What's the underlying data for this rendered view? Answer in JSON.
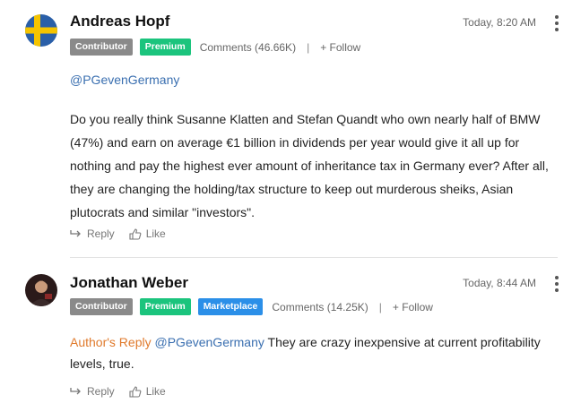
{
  "comments": [
    {
      "author": "Andreas Hopf",
      "avatar_icon": "sweden-flag-icon",
      "timestamp": "Today, 8:20 AM",
      "badges": [
        "Contributor",
        "Premium"
      ],
      "comments_label": "Comments (46.66K)",
      "separator": "|",
      "follow_label": "+ Follow",
      "mention": "@PGevenGermany",
      "body": "Do you really think Susanne Klatten and Stefan Quandt who own nearly half of BMW (47%) and earn on average €1 billion in dividends per year would give it all up for nothing and pay the highest ever amount of inheritance tax in Germany ever? After all, they are changing the holding/tax structure to keep out murderous sheiks, Asian plutocrats and similar \"investors\".",
      "reply_label": "Reply",
      "like_label": "Like"
    },
    {
      "author": "Jonathan Weber",
      "avatar_icon": "user-photo-avatar",
      "timestamp": "Today, 8:44 AM",
      "badges": [
        "Contributor",
        "Premium",
        "Marketplace"
      ],
      "comments_label": "Comments (14.25K)",
      "separator": "|",
      "follow_label": "+ Follow",
      "author_reply_label": "Author's Reply",
      "mention": "@PGevenGermany",
      "body": " They are crazy inexpensive at current profitability levels, true.",
      "reply_label": "Reply",
      "like_label": "Like"
    }
  ],
  "colors": {
    "contributor_badge": "#8a8a8a",
    "premium_badge": "#1bc47d",
    "marketplace_badge": "#2b8fe8",
    "mention": "#3a6fb0",
    "author_reply": "#e07a2c"
  }
}
